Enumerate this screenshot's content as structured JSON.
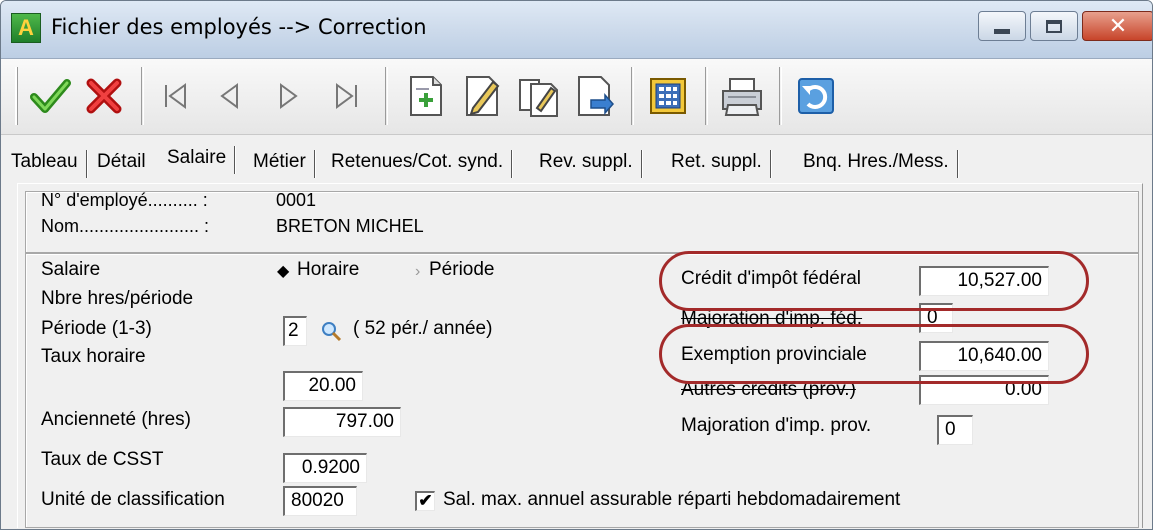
{
  "window": {
    "title": "Fichier des employés  --> Correction"
  },
  "toolbar": {
    "icons": [
      "accept-icon",
      "cancel-icon",
      "first-record-icon",
      "previous-record-icon",
      "next-record-icon",
      "last-record-icon",
      "new-document-icon",
      "edit-icon",
      "edit-all-icon",
      "export-icon",
      "calculator-icon",
      "print-icon",
      "undo-icon"
    ]
  },
  "tabs": [
    {
      "label": "Tableau"
    },
    {
      "label": "Détail"
    },
    {
      "label": "Salaire"
    },
    {
      "label": "Métier"
    },
    {
      "label": "Retenues/Cot. synd."
    },
    {
      "label": "Rev. suppl."
    },
    {
      "label": "Ret. suppl."
    },
    {
      "label": "Bnq. Hres./Mess."
    }
  ],
  "employee": {
    "num_label": "N° d'employé.......... :",
    "num_value": "0001",
    "name_label": "Nom........................ :",
    "name_value": "BRETON MICHEL"
  },
  "salary": {
    "salaire_label": "Salaire",
    "radio_horaire": "Horaire",
    "radio_periode": "Période",
    "selected": "Horaire",
    "nbre_label": "Nbre hres/période",
    "periode_label": "Période (1-3)",
    "periode_value": "2",
    "per_annee": "( 52  pér./ année)",
    "taux_label": "Taux horaire",
    "taux_value": "20.00",
    "anciennete_label": "Ancienneté (hres)",
    "anciennete_value": "797.00",
    "csst_label": "Taux de CSST",
    "csst_value": "0.9200",
    "unite_label": "Unité de classification",
    "unite_value": "80020",
    "salmax_label": "Sal. max. annuel assurable réparti hebdomadairement",
    "salmax_checked": true
  },
  "credits": {
    "federal_label": "Crédit d'impôt fédéral",
    "federal_value": "10,527.00",
    "maj_fed_label": "Majoration d'imp. féd.",
    "maj_fed_value": "0",
    "exemption_label": "Exemption provinciale",
    "exemption_value": "10,640.00",
    "autres_label": "Autres crédits (prov.)",
    "autres_value": "0.00",
    "maj_prov_label": "Majoration d'imp. prov.",
    "maj_prov_value": "0"
  },
  "colors": {
    "highlight_oval": "#a32a2a"
  }
}
